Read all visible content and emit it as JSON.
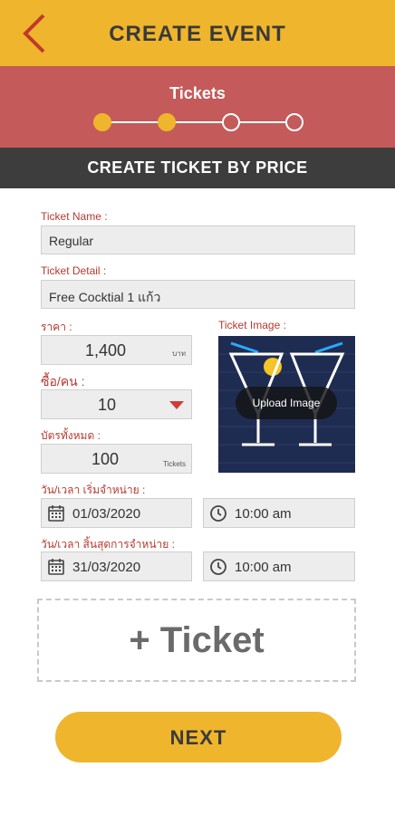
{
  "header": {
    "title": "CREATE EVENT"
  },
  "steps": {
    "title": "Tickets",
    "active_count": 2,
    "total": 4
  },
  "section": {
    "title": "CREATE TICKET BY PRICE"
  },
  "form": {
    "ticket_name": {
      "label": "Ticket Name :",
      "value": "Regular"
    },
    "ticket_detail": {
      "label": "Ticket Detail :",
      "value": "Free Cocktial 1 แก้ว"
    },
    "price": {
      "label": "ราคา :",
      "value": "1,400",
      "unit": "บาท"
    },
    "per_person": {
      "label": "ซื้อ/คน :",
      "value": "10"
    },
    "total_tickets": {
      "label": "บัตรทั้งหมด :",
      "value": "100",
      "unit": "Tickets"
    },
    "sale_start": {
      "label": "วัน/เวลา เริ่มจำหน่าย :",
      "date": "01/03/2020",
      "time": "10:00 am"
    },
    "sale_end": {
      "label": "วัน/เวลา สิ้นสุดการจำหน่าย :",
      "date": "31/03/2020",
      "time": "10:00 am"
    },
    "image": {
      "label": "Ticket Image :",
      "upload_label": "Upload Image"
    }
  },
  "actions": {
    "add_ticket": "+ Ticket",
    "next": "NEXT"
  },
  "colors": {
    "accent": "#efb52c",
    "step_bar": "#c45a5a",
    "section_bar": "#3d3d3d",
    "label": "#b8392f",
    "arrow": "#d33a3a"
  },
  "icons": [
    "back-chevron-icon",
    "chevron-down-icon",
    "calendar-icon",
    "clock-icon"
  ]
}
